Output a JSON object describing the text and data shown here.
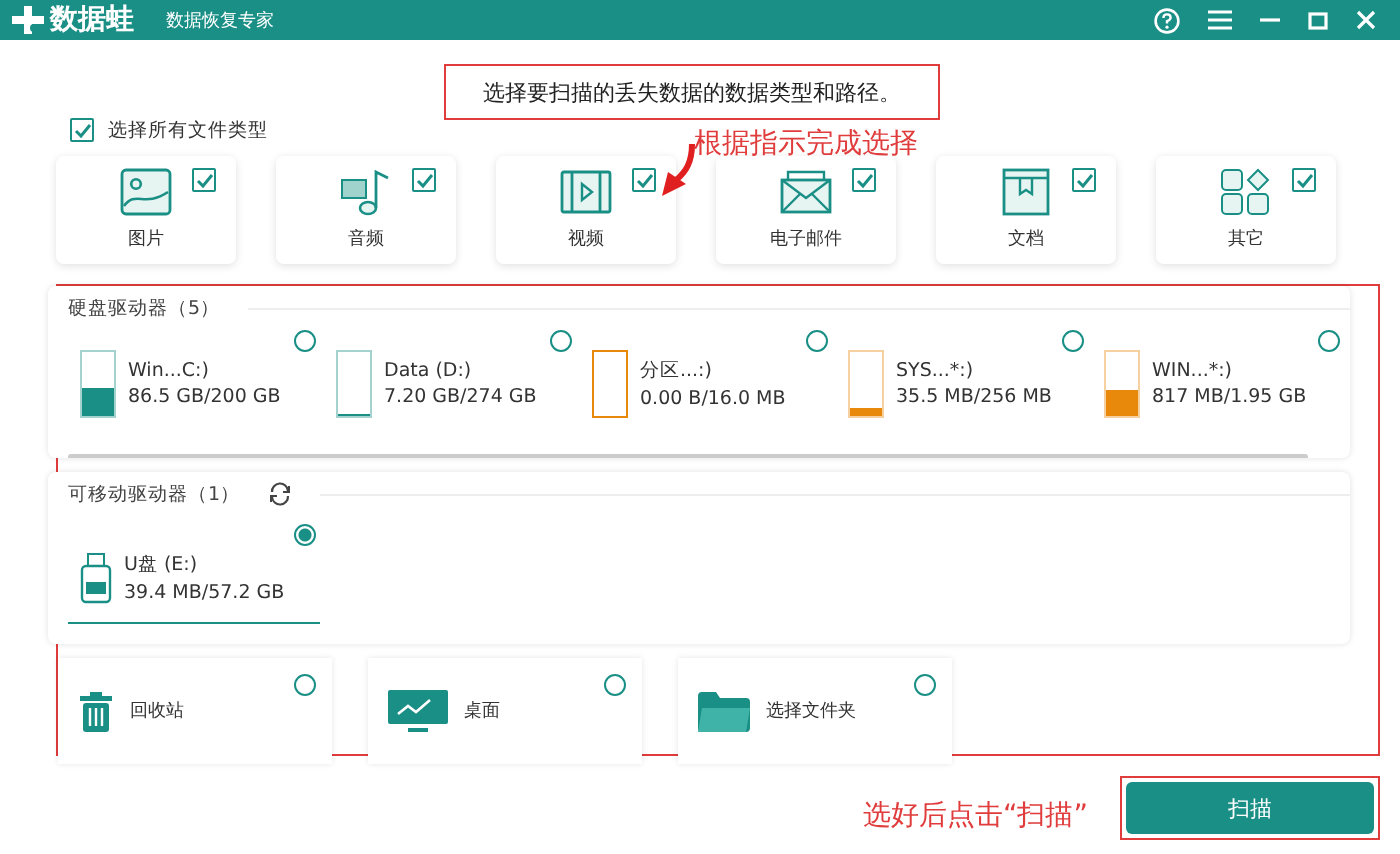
{
  "window": {
    "app_name": "数据蛙",
    "subtitle": "数据恢复专家"
  },
  "annotations": {
    "instruction": "选择要扫描的丢失数据的数据类型和路径。",
    "hint": "根据指示完成选择",
    "scan_hint": "选好后点击“扫描”"
  },
  "select_all": {
    "label": "选择所有文件类型",
    "checked": true
  },
  "file_types": [
    {
      "label": "图片",
      "kind": "image",
      "checked": true
    },
    {
      "label": "音频",
      "kind": "audio",
      "checked": true
    },
    {
      "label": "视频",
      "kind": "video",
      "checked": true
    },
    {
      "label": "电子邮件",
      "kind": "email",
      "checked": true
    },
    {
      "label": "文档",
      "kind": "document",
      "checked": true
    },
    {
      "label": "其它",
      "kind": "other",
      "checked": true
    }
  ],
  "hard_drives": {
    "title": "硬盘驱动器（5）",
    "drives": [
      {
        "name": "Win...C:)",
        "usage": "86.5 GB/200 GB",
        "level": 0.43,
        "color": "#1a8f86",
        "selected": false
      },
      {
        "name": "Data (D:)",
        "usage": "7.20 GB/274 GB",
        "level": 0.03,
        "color": "#1a8f86",
        "selected": false
      },
      {
        "name": "分区...:)",
        "usage": "0.00  B/16.0 MB",
        "level": 0,
        "color": "#e8890c",
        "selected": false
      },
      {
        "name": "SYS...*:)",
        "usage": "35.5 MB/256 MB",
        "level": 0.14,
        "color": "#e8890c",
        "selected": false
      },
      {
        "name": "WIN...*:)",
        "usage": "817 MB/1.95 GB",
        "level": 0.42,
        "color": "#e8890c",
        "selected": false
      }
    ]
  },
  "removable": {
    "title": "可移动驱动器（1）",
    "drives": [
      {
        "name": "U盘 (E:)",
        "usage": "39.4 MB/57.2 GB",
        "selected": true
      }
    ]
  },
  "locations": [
    {
      "label": "回收站",
      "kind": "recycle",
      "selected": false
    },
    {
      "label": "桌面",
      "kind": "desktop",
      "selected": false
    },
    {
      "label": "选择文件夹",
      "kind": "folder",
      "selected": false
    }
  ],
  "scan_button": "扫描"
}
